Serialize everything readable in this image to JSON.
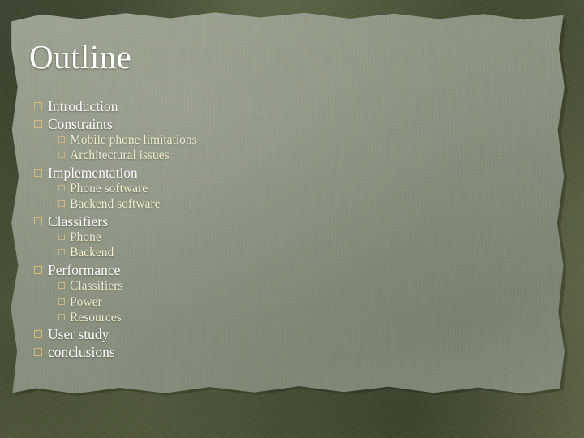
{
  "slide": {
    "title": "Outline",
    "colors": {
      "border": "#5d6349",
      "paper": "#8f9583",
      "title_text": "#ffffff",
      "level1_text": "#fefefe",
      "level2_text": "#f4edd2",
      "level1_bullet": "#d9b979",
      "level2_bullet": "#cdb486"
    },
    "bullet_icon": "hollow-square-bullet",
    "outline": [
      {
        "level": 1,
        "text": "Introduction"
      },
      {
        "level": 1,
        "text": "Constraints"
      },
      {
        "level": 2,
        "text": "Mobile phone limitations"
      },
      {
        "level": 2,
        "text": "Architectural issues"
      },
      {
        "level": 1,
        "text": "Implementation"
      },
      {
        "level": 2,
        "text": "Phone software"
      },
      {
        "level": 2,
        "text": "Backend software"
      },
      {
        "level": 1,
        "text": "Classifiers"
      },
      {
        "level": 2,
        "text": "Phone"
      },
      {
        "level": 2,
        "text": "Backend"
      },
      {
        "level": 1,
        "text": "Performance"
      },
      {
        "level": 2,
        "text": "Classifiers"
      },
      {
        "level": 2,
        "text": "Power"
      },
      {
        "level": 2,
        "text": "Resources"
      },
      {
        "level": 1,
        "text": "User study"
      },
      {
        "level": 1,
        "text": "conclusions"
      }
    ]
  }
}
